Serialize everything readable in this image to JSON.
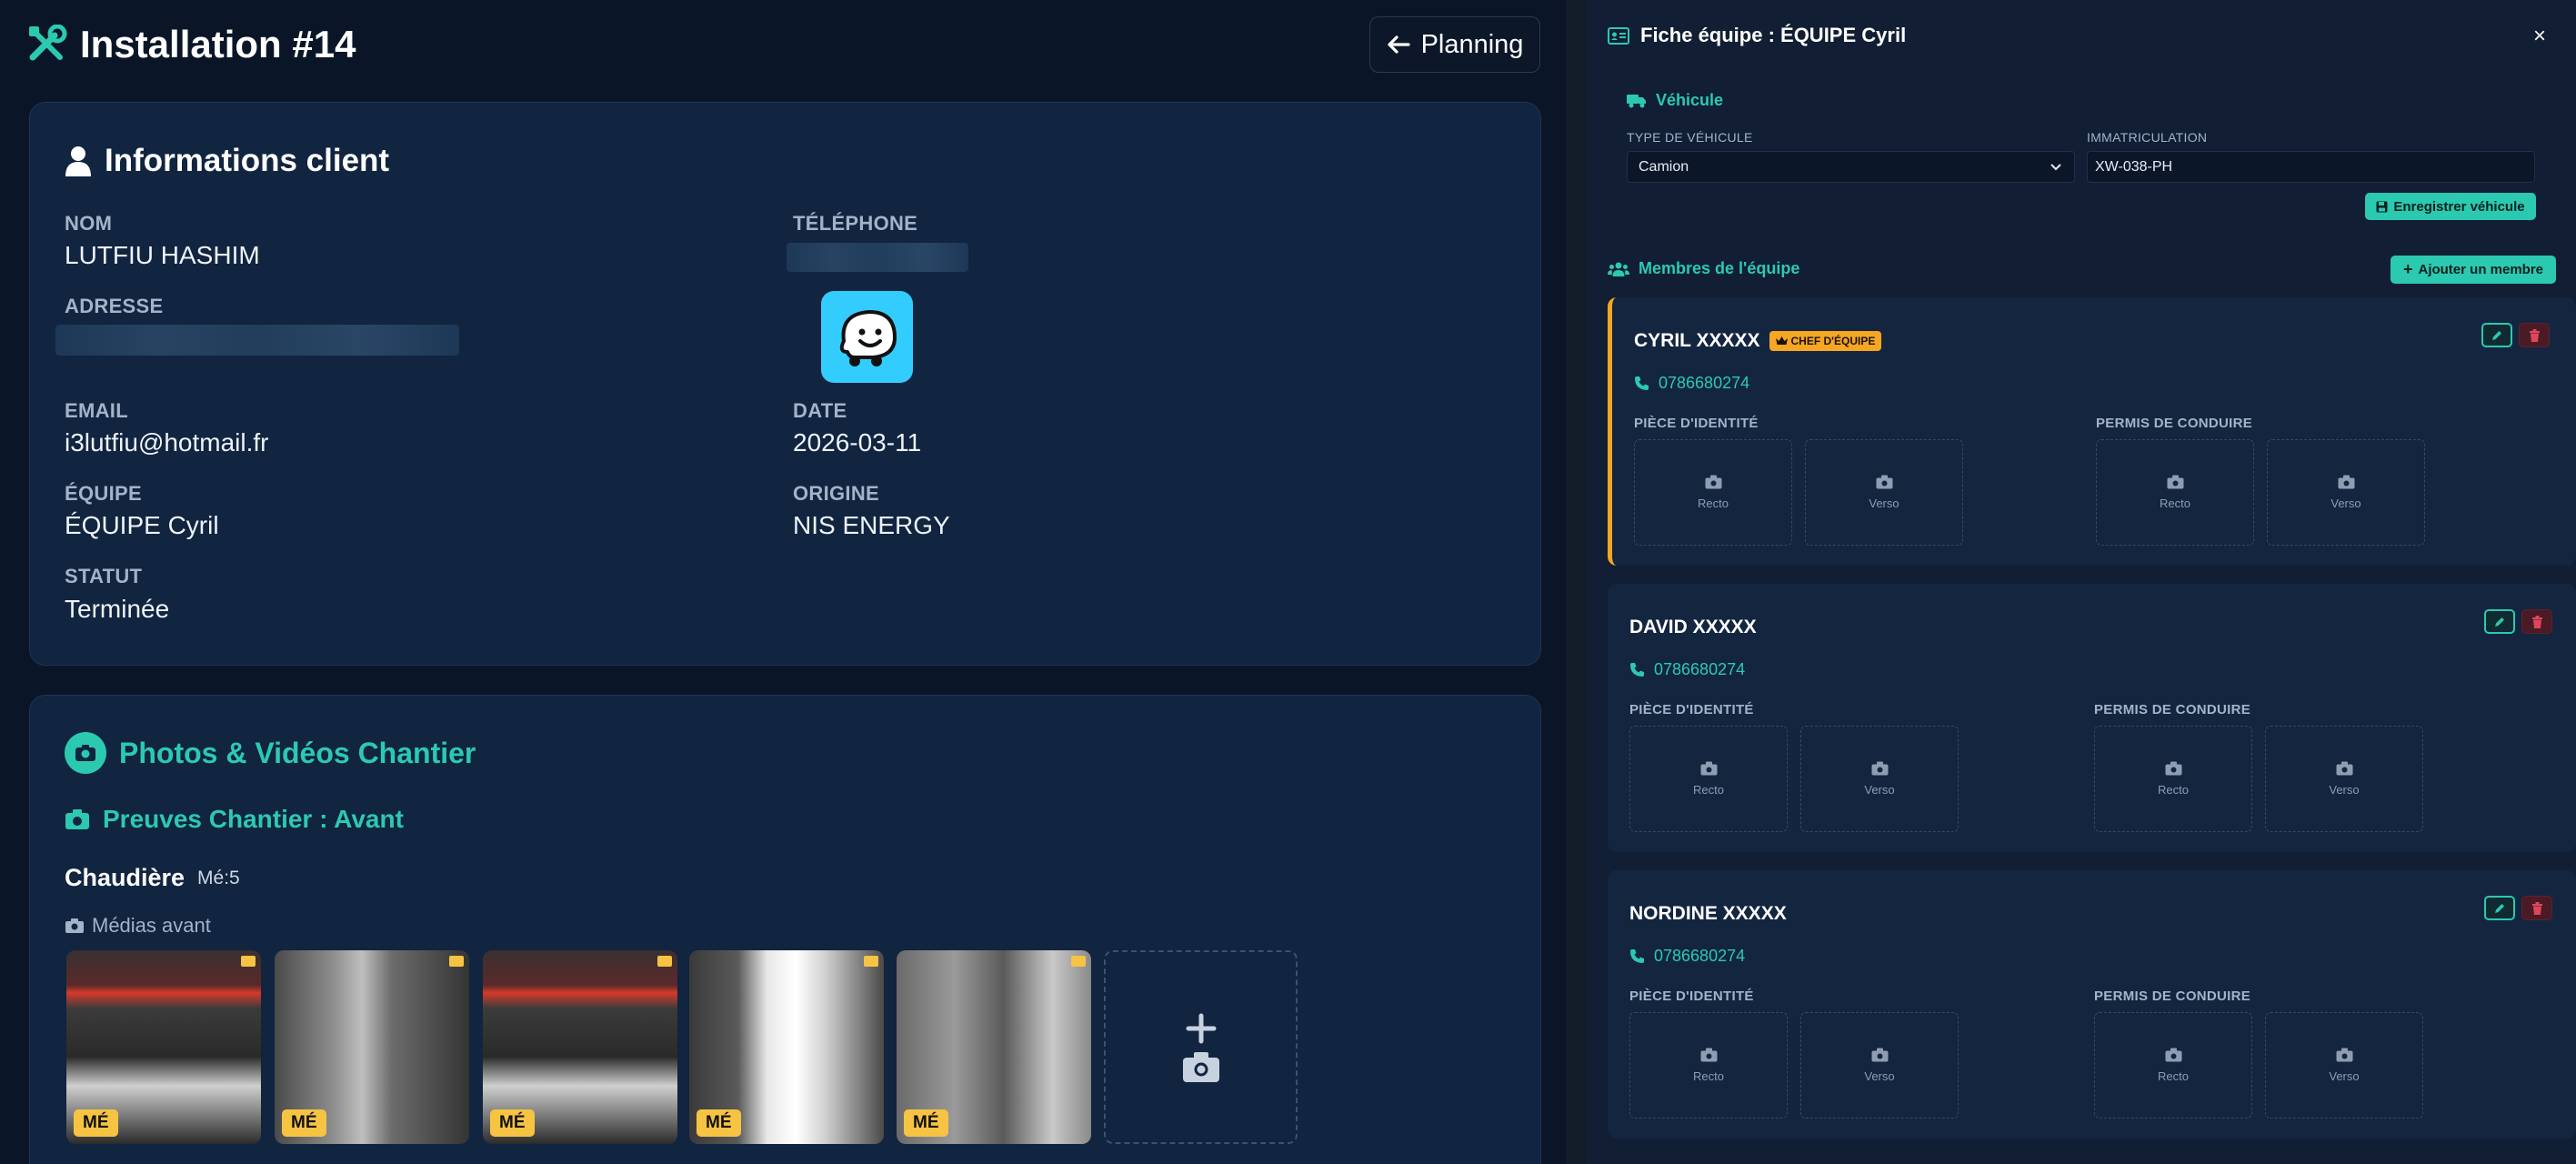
{
  "page": {
    "title": "Installation #14",
    "planning_button": "Planning"
  },
  "client": {
    "heading": "Informations client",
    "nom_label": "NOM",
    "nom_value": "LUTFIU HASHIM",
    "telephone_label": "TÉLÉPHONE",
    "adresse_label": "ADRESSE",
    "email_label": "EMAIL",
    "email_value": "i3lutfiu@hotmail.fr",
    "date_label": "DATE",
    "date_value": "2026-03-11",
    "equipe_label": "ÉQUIPE",
    "equipe_value": "ÉQUIPE Cyril",
    "origine_label": "ORIGINE",
    "origine_value": "NIS ENERGY",
    "statut_label": "STATUT",
    "statut_value": "Terminée"
  },
  "photos": {
    "heading": "Photos & Vidéos Chantier",
    "subheading": "Preuves Chantier : Avant",
    "group_title": "Chaudière",
    "group_count": "Mé:5",
    "media_label": "Médias avant",
    "thumbs": [
      {
        "badge": "MÉ"
      },
      {
        "badge": "MÉ"
      },
      {
        "badge": "MÉ"
      },
      {
        "badge": "MÉ"
      },
      {
        "badge": "MÉ"
      }
    ]
  },
  "panel": {
    "title": "Fiche équipe : ÉQUIPE Cyril",
    "close": "×",
    "vehicle": {
      "heading": "Véhicule",
      "type_label": "TYPE DE VÉHICULE",
      "type_value": "Camion",
      "plate_label": "IMMATRICULATION",
      "plate_value": "XW-038-PH",
      "save_button": "Enregistrer véhicule"
    },
    "members_heading": "Membres de l'équipe",
    "add_member_button": "Ajouter un membre",
    "members": [
      {
        "name": "CYRIL XXXXX",
        "chef_badge": "CHEF D'ÉQUIPE",
        "phone": "0786680274",
        "id_label": "PIÈCE D'IDENTITÉ",
        "license_label": "PERMIS DE CONDUIRE",
        "recto": "Recto",
        "verso": "Verso"
      },
      {
        "name": "DAVID XXXXX",
        "phone": "0786680274",
        "id_label": "PIÈCE D'IDENTITÉ",
        "license_label": "PERMIS DE CONDUIRE",
        "recto": "Recto",
        "verso": "Verso"
      },
      {
        "name": "NORDINE XXXXX",
        "phone": "0786680274",
        "id_label": "PIÈCE D'IDENTITÉ",
        "license_label": "PERMIS DE CONDUIRE",
        "recto": "Recto",
        "verso": "Verso"
      }
    ]
  },
  "colors": {
    "accent": "#2cc9b1",
    "chef": "#f5a623",
    "badge": "#f6c343",
    "danger": "#e0465b",
    "card": "#112440",
    "background": "#0a1628"
  }
}
